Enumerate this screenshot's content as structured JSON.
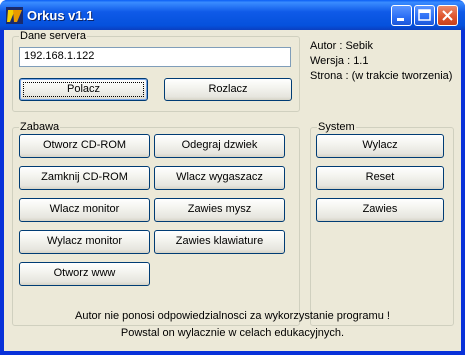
{
  "window": {
    "title": "Orkus v1.1",
    "icon": "app-logo-icon",
    "controls": [
      "minimize-icon",
      "maximize-icon",
      "close-icon"
    ]
  },
  "server": {
    "group_label": "Dane servera",
    "ip_value": "192.168.1.122",
    "connect_label": "Polacz",
    "disconnect_label": "Rozlacz"
  },
  "info": {
    "author": "Autor : Sebik",
    "version": "Wersja : 1.1",
    "website": "Strona : (w trakcie tworzenia)"
  },
  "fun": {
    "group_label": "Zabawa",
    "buttons": [
      "Otworz CD-ROM",
      "Odegraj dzwiek",
      "Zamknij CD-ROM",
      "Wlacz wygaszacz",
      "Wlacz monitor",
      "Zawies mysz",
      "Wylacz monitor",
      "Zawies klawiature",
      "Otworz www"
    ]
  },
  "system": {
    "group_label": "System",
    "buttons": [
      "Wylacz",
      "Reset",
      "Zawies"
    ]
  },
  "footer": {
    "line1": "Autor nie ponosi odpowiedzialnosci za wykorzystanie programu !",
    "line2": "Powstal on wylacznie w celach edukacyjnych."
  },
  "colors": {
    "titlebar": "#0551dc",
    "client_bg": "#ece9d8",
    "close_button": "#e0562f"
  }
}
